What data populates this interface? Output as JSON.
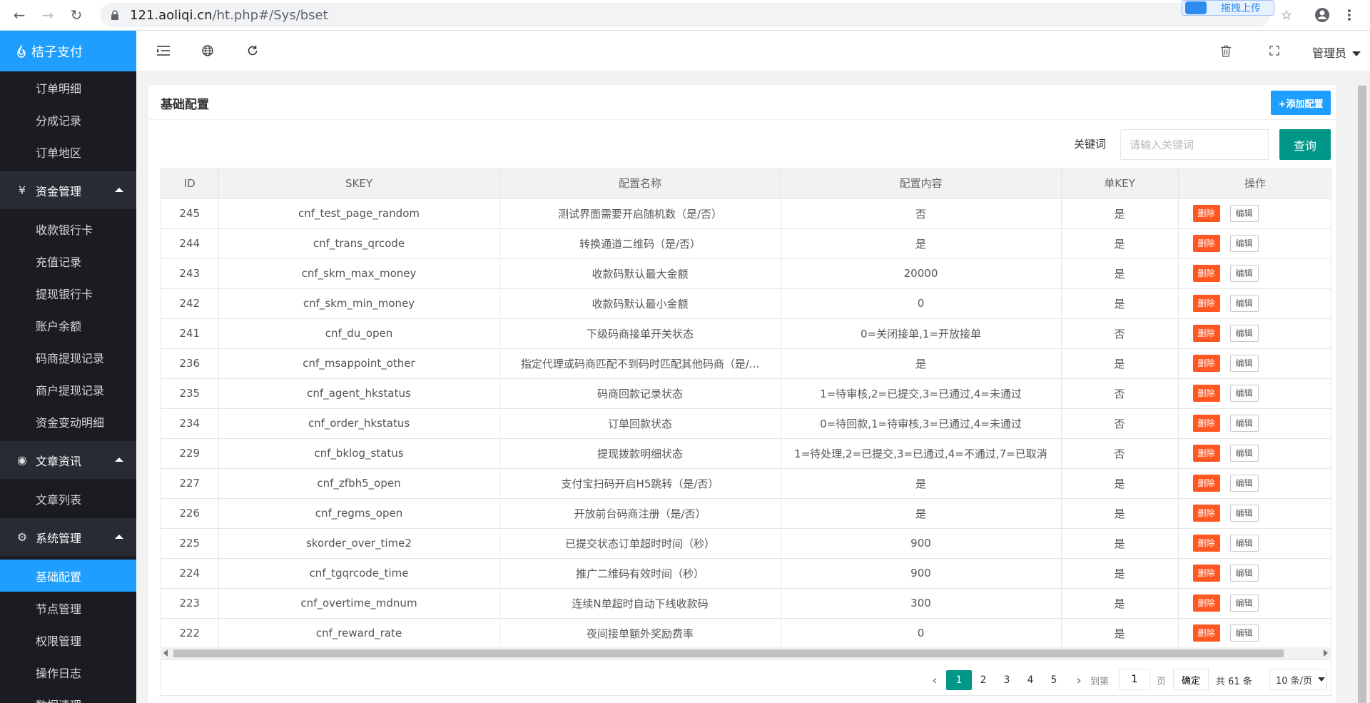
{
  "browser": {
    "url_host": "121.aoliqi.cn",
    "url_path": "/ht.php#/Sys/bset",
    "extension_label": "拖拽上传"
  },
  "sidebar": {
    "app_title": "桔子支付",
    "items_top": [
      {
        "label": "订单明细"
      },
      {
        "label": "分成记录"
      },
      {
        "label": "订单地区"
      }
    ],
    "groups": [
      {
        "label": "资金管理",
        "icon": "yen-icon",
        "items": [
          {
            "label": "收款银行卡"
          },
          {
            "label": "充值记录"
          },
          {
            "label": "提现银行卡"
          },
          {
            "label": "账户余额"
          },
          {
            "label": "码商提现记录"
          },
          {
            "label": "商户提现记录"
          },
          {
            "label": "资金变动明细"
          }
        ]
      },
      {
        "label": "文章资讯",
        "icon": "palette-icon",
        "items": [
          {
            "label": "文章列表"
          }
        ]
      },
      {
        "label": "系统管理",
        "icon": "gear-icon",
        "items": [
          {
            "label": "基础配置",
            "active": true
          },
          {
            "label": "节点管理"
          },
          {
            "label": "权限管理"
          },
          {
            "label": "操作日志"
          },
          {
            "label": "数据清理"
          }
        ]
      }
    ]
  },
  "header": {
    "admin_label": "管理员"
  },
  "card": {
    "title": "基础配置",
    "add_button": "+添加配置",
    "keyword_label": "关键词",
    "keyword_placeholder": "请输入关键词",
    "query_button": "查询"
  },
  "table": {
    "columns": [
      "ID",
      "SKEY",
      "配置名称",
      "配置内容",
      "单KEY",
      "操作"
    ],
    "delete_label": "删除",
    "edit_label": "编辑",
    "rows": [
      [
        "245",
        "cnf_test_page_random",
        "测试界面需要开启随机数（是/否）",
        "否",
        "是"
      ],
      [
        "244",
        "cnf_trans_qrcode",
        "转换通道二维码（是/否）",
        "是",
        "是"
      ],
      [
        "243",
        "cnf_skm_max_money",
        "收款码默认最大金额",
        "20000",
        "是"
      ],
      [
        "242",
        "cnf_skm_min_money",
        "收款码默认最小金额",
        "0",
        "是"
      ],
      [
        "241",
        "cnf_du_open",
        "下级码商接单开关状态",
        "0=关闭接单,1=开放接单",
        "否"
      ],
      [
        "236",
        "cnf_msappoint_other",
        "指定代理或码商匹配不到码时匹配其他码商（是/...",
        "是",
        "是"
      ],
      [
        "235",
        "cnf_agent_hkstatus",
        "码商回款记录状态",
        "1=待审核,2=已提交,3=已通过,4=未通过",
        "否"
      ],
      [
        "234",
        "cnf_order_hkstatus",
        "订单回款状态",
        "0=待回款,1=待审核,3=已通过,4=未通过",
        "否"
      ],
      [
        "229",
        "cnf_bklog_status",
        "提现拨款明细状态",
        "1=待处理,2=已提交,3=已通过,4=不通过,7=已取消",
        "否"
      ],
      [
        "227",
        "cnf_zfbh5_open",
        "支付宝扫码开启H5跳转（是/否）",
        "是",
        "是"
      ],
      [
        "226",
        "cnf_regms_open",
        "开放前台码商注册（是/否）",
        "是",
        "是"
      ],
      [
        "225",
        "skorder_over_time2",
        "已提交状态订单超时时间（秒）",
        "900",
        "是"
      ],
      [
        "224",
        "cnf_tgqrcode_time",
        "推广二维码有效时间（秒）",
        "900",
        "是"
      ],
      [
        "223",
        "cnf_overtime_mdnum",
        "连续N单超时自动下线收款码",
        "300",
        "是"
      ],
      [
        "222",
        "cnf_reward_rate",
        "夜间接单额外奖励费率",
        "0",
        "是"
      ]
    ]
  },
  "pagination": {
    "pages": [
      "1",
      "2",
      "3",
      "4",
      "5"
    ],
    "current": "1",
    "goto_label": "到第",
    "goto_value": "1",
    "page_unit": "页",
    "confirm": "确定",
    "total": "共 61 条",
    "page_size": "10 条/页"
  }
}
